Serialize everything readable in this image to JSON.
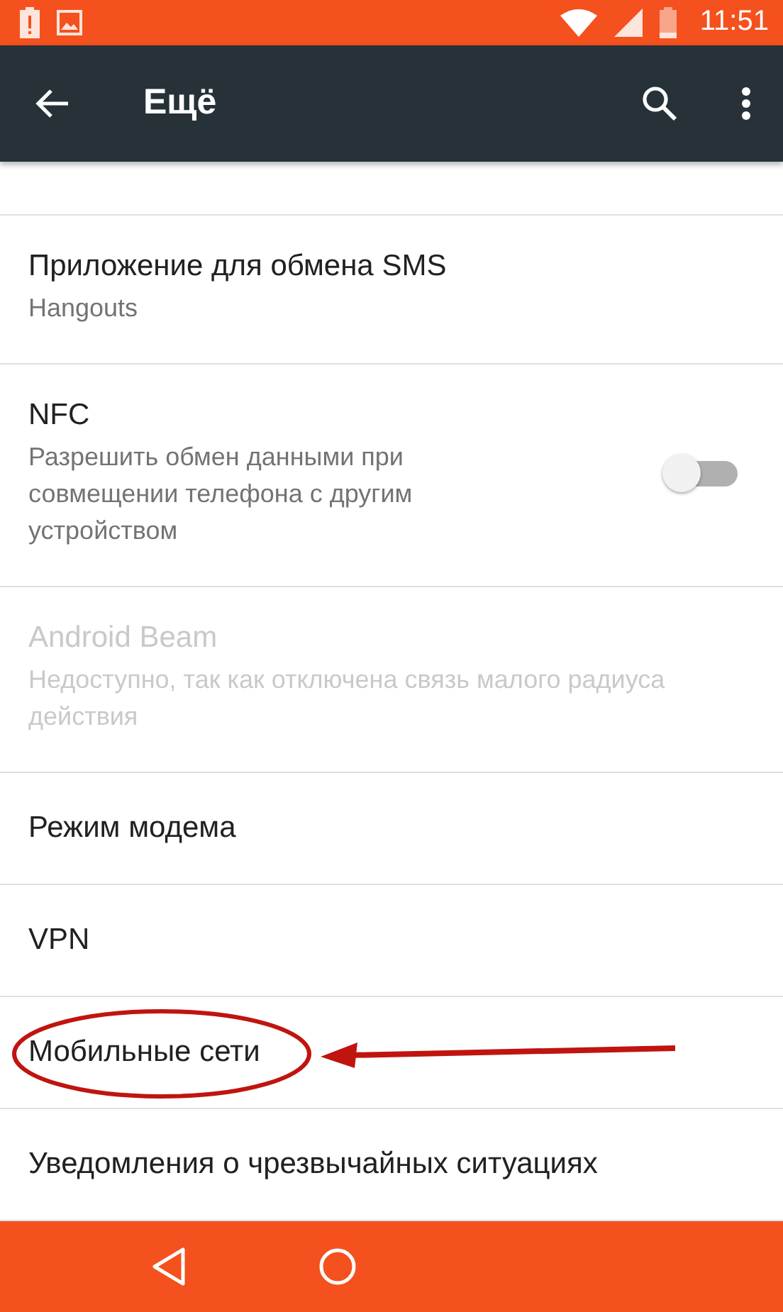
{
  "status_bar": {
    "time": "11:51"
  },
  "toolbar": {
    "title": "Ещё"
  },
  "items": [
    {
      "kind": "text",
      "title": "Приложение для обмена SMS",
      "summary": "Hangouts",
      "disabled": false
    },
    {
      "kind": "toggle",
      "title": "NFC",
      "summary": "Разрешить обмен данными при совмещении телефона с другим устройством",
      "disabled": false,
      "on": false
    },
    {
      "kind": "text",
      "title": "Android Beam",
      "summary": "Недоступно, так как отключена связь малого радиуса действия",
      "disabled": true
    },
    {
      "kind": "text",
      "title": "Режим модема",
      "disabled": false
    },
    {
      "kind": "text",
      "title": "VPN",
      "disabled": false
    },
    {
      "kind": "text",
      "title": "Мобильные сети",
      "disabled": false,
      "annotated": true
    },
    {
      "kind": "text",
      "title": "Уведомления о чрезвычайных ситуациях",
      "disabled": false
    }
  ]
}
